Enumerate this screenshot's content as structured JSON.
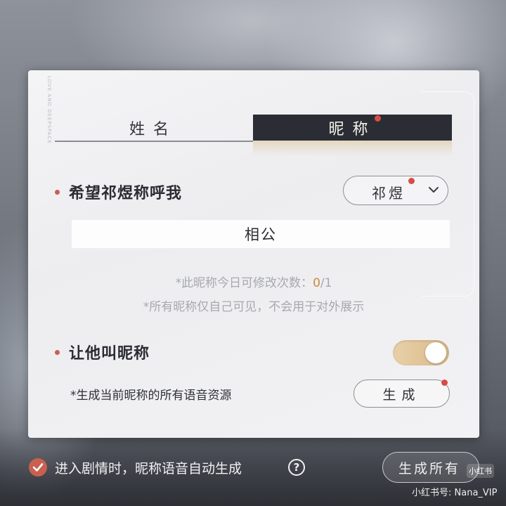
{
  "tabs": [
    {
      "label": "姓名",
      "active": false
    },
    {
      "label": "昵称",
      "active": true
    }
  ],
  "panel_deco_text": "LOVE AND DEEPSPACE",
  "preferred_title": {
    "label": "希望祁煜称呼我",
    "dropdown_value": "祁煜"
  },
  "nickname_value": "相公",
  "hints": {
    "edit_prefix": "*此昵称今日可修改次数：",
    "edit_used": "0",
    "edit_total": "/1",
    "privacy": "*所有昵称仅自己可见，不会用于对外展示"
  },
  "let_him_call": {
    "label": "让他叫昵称",
    "toggle_on": true,
    "resource_label": "*生成当前昵称的所有语音资源",
    "generate_button": "生成"
  },
  "footer": {
    "auto_generate_label": "进入剧情时，昵称语音自动生成",
    "auto_generate_checked": true,
    "help_symbol": "?",
    "generate_all_button": "生成所有"
  },
  "watermark": {
    "badge": "小红书",
    "text": "小红书号: Nana_VIP"
  },
  "colors": {
    "accent_dark": "#2a2d34",
    "red_dot": "#d94c44",
    "bullet": "#c9604f",
    "toggle_gold": "#d9b98a",
    "count_used": "#c98a3c"
  }
}
